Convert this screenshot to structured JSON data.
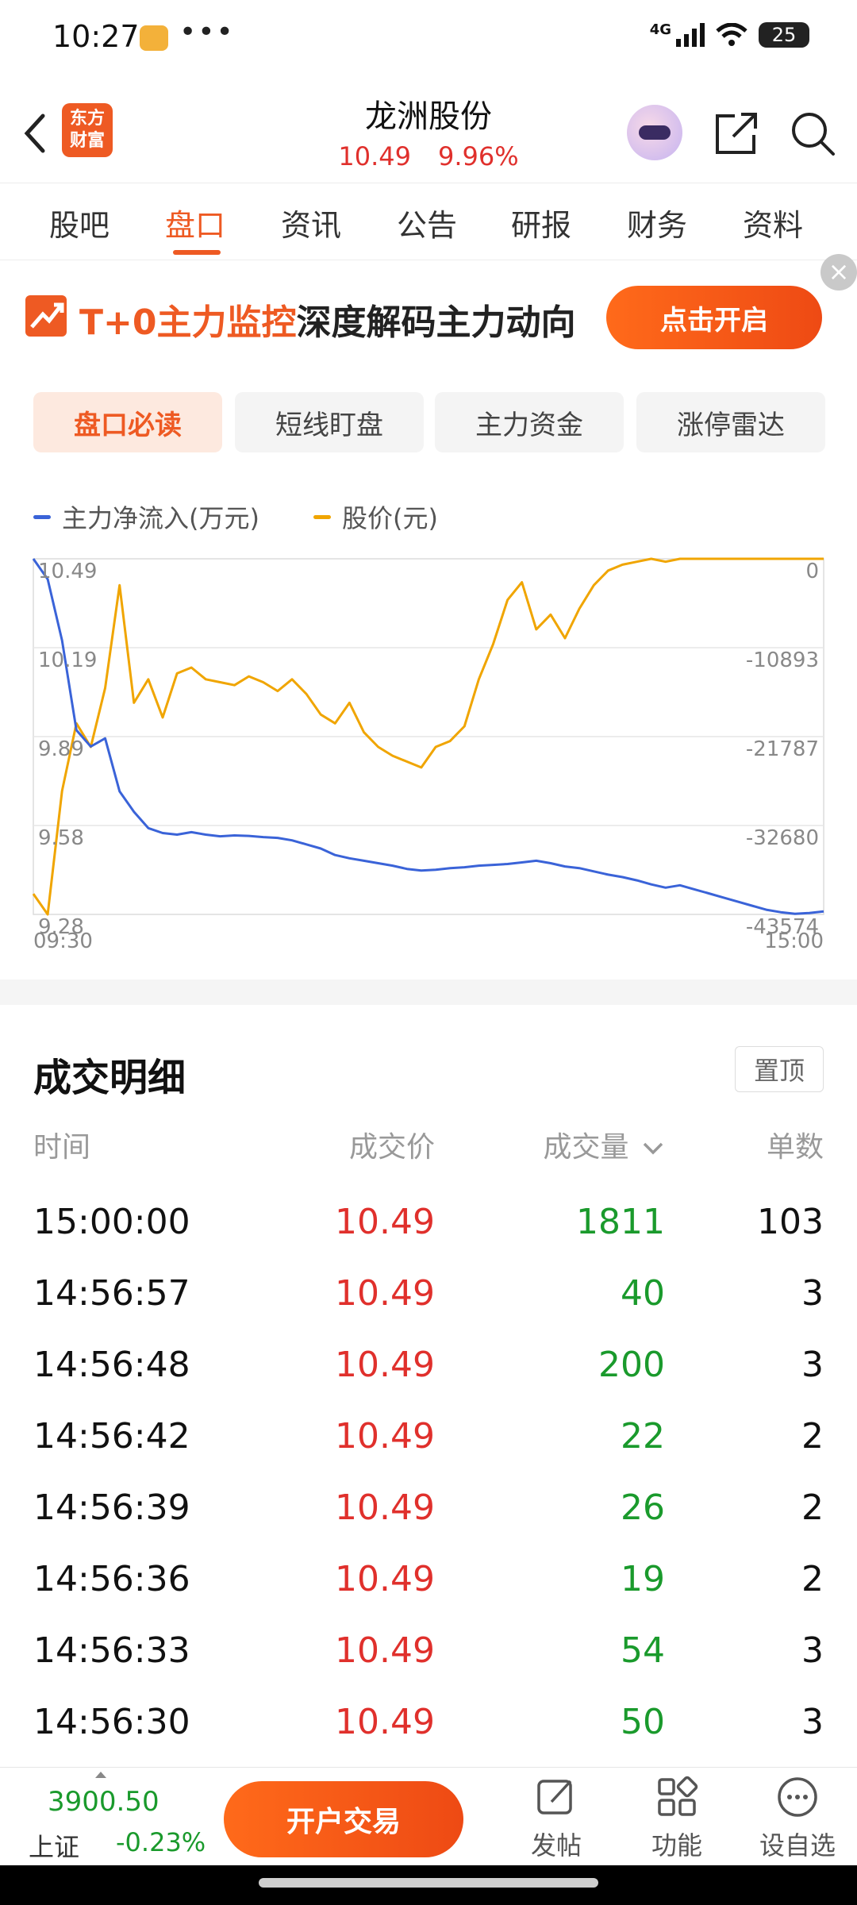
{
  "status": {
    "time": "10:27",
    "dots": "•••",
    "network": "4G",
    "battery": "25"
  },
  "header": {
    "stock_name": "龙洲股份",
    "price": "10.49",
    "change_pct": "9.96%",
    "logo_line1": "东方",
    "logo_line2": "财富"
  },
  "tabs": [
    {
      "label": "股吧"
    },
    {
      "label": "盘口"
    },
    {
      "label": "资讯"
    },
    {
      "label": "公告"
    },
    {
      "label": "研报"
    },
    {
      "label": "财务"
    },
    {
      "label": "资料"
    }
  ],
  "banner": {
    "highlight": "T+0主力监控",
    "text": "深度解码主力动向",
    "button": "点击开启",
    "close": "×"
  },
  "subtabs": [
    {
      "label": "盘口必读"
    },
    {
      "label": "短线盯盘"
    },
    {
      "label": "主力资金"
    },
    {
      "label": "涨停雷达"
    }
  ],
  "legend": {
    "flow": "主力净流入(万元)",
    "price": "股价(元)"
  },
  "colors": {
    "flow": "#3a63d8",
    "price": "#f0a500",
    "accent": "#ee5a23",
    "up": "#e0302c",
    "down": "#1a9a2c"
  },
  "chart_data": {
    "type": "line",
    "x_start": "09:30",
    "x_end": "15:00",
    "left_axis": {
      "label": "股价(元)",
      "ticks": [
        "10.49",
        "10.19",
        "9.89",
        "9.58",
        "9.28"
      ],
      "range": [
        9.28,
        10.49
      ]
    },
    "right_axis": {
      "label": "主力净流入(万元)",
      "ticks": [
        "0",
        "-10893",
        "-21787",
        "-32680",
        "-43574"
      ],
      "range": [
        -43574,
        0
      ]
    },
    "series": [
      {
        "name": "股价(元)",
        "axis": "left",
        "values": [
          9.35,
          9.28,
          9.7,
          9.93,
          9.85,
          10.05,
          10.4,
          10.0,
          10.08,
          9.95,
          10.1,
          10.12,
          10.08,
          10.07,
          10.06,
          10.09,
          10.07,
          10.04,
          10.08,
          10.03,
          9.96,
          9.93,
          10.0,
          9.9,
          9.85,
          9.82,
          9.8,
          9.78,
          9.85,
          9.87,
          9.92,
          10.08,
          10.2,
          10.35,
          10.41,
          10.25,
          10.3,
          10.22,
          10.32,
          10.4,
          10.45,
          10.47,
          10.48,
          10.49,
          10.48,
          10.49,
          10.49,
          10.49,
          10.49,
          10.49,
          10.49,
          10.49,
          10.49,
          10.49,
          10.49,
          10.49
        ]
      },
      {
        "name": "主力净流入(万元)",
        "axis": "right",
        "values": [
          0,
          -2500,
          -10000,
          -21000,
          -23000,
          -22000,
          -28500,
          -31000,
          -33000,
          -33600,
          -33800,
          -33500,
          -33800,
          -34000,
          -33900,
          -33950,
          -34100,
          -34200,
          -34500,
          -35000,
          -35500,
          -36300,
          -36700,
          -37000,
          -37300,
          -37600,
          -38000,
          -38200,
          -38100,
          -37900,
          -37800,
          -37600,
          -37500,
          -37400,
          -37200,
          -37000,
          -37300,
          -37700,
          -37900,
          -38300,
          -38700,
          -39000,
          -39400,
          -39900,
          -40300,
          -40000,
          -40500,
          -41000,
          -41500,
          -42000,
          -42500,
          -43000,
          -43300,
          -43500,
          -43400,
          -43200
        ]
      }
    ]
  },
  "trades": {
    "title": "成交明细",
    "pin": "置顶",
    "headers": {
      "time": "时间",
      "price": "成交价",
      "volume": "成交量",
      "count": "单数"
    },
    "rows": [
      {
        "time": "15:00:00",
        "price": "10.49",
        "volume": "1811",
        "count": "103"
      },
      {
        "time": "14:56:57",
        "price": "10.49",
        "volume": "40",
        "count": "3"
      },
      {
        "time": "14:56:48",
        "price": "10.49",
        "volume": "200",
        "count": "3"
      },
      {
        "time": "14:56:42",
        "price": "10.49",
        "volume": "22",
        "count": "2"
      },
      {
        "time": "14:56:39",
        "price": "10.49",
        "volume": "26",
        "count": "2"
      },
      {
        "time": "14:56:36",
        "price": "10.49",
        "volume": "19",
        "count": "2"
      },
      {
        "time": "14:56:33",
        "price": "10.49",
        "volume": "54",
        "count": "3"
      },
      {
        "time": "14:56:30",
        "price": "10.49",
        "volume": "50",
        "count": "3"
      }
    ]
  },
  "bottom": {
    "index_value": "3900.50",
    "index_name": "上证",
    "index_change": "-0.23%",
    "trade_button": "开户交易",
    "nav": [
      {
        "label": "发帖",
        "icon": "edit-icon"
      },
      {
        "label": "功能",
        "icon": "grid-icon"
      },
      {
        "label": "设自选",
        "icon": "more-icon"
      }
    ]
  }
}
